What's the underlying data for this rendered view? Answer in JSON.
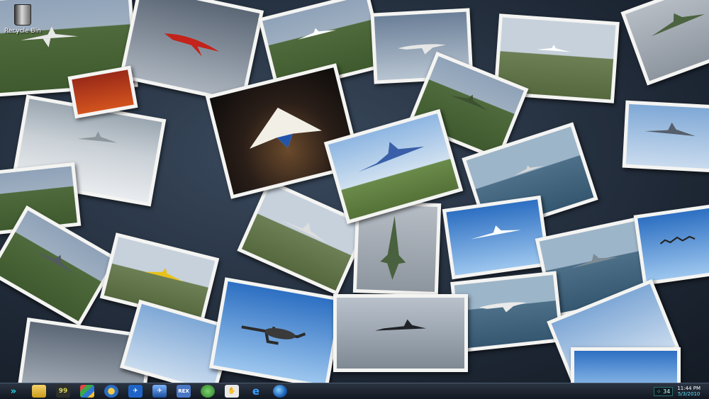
{
  "desktop": {
    "icons": [
      {
        "label": "Recycle Bin",
        "icon": "recycle-bin-icon"
      }
    ],
    "wallpaper_description_icon": "aircraft-photo-collage"
  },
  "taskbar": {
    "start_label": "»",
    "pinned": [
      {
        "name": "folder-icon",
        "label": ""
      },
      {
        "name": "app-99-icon",
        "label": "99"
      },
      {
        "name": "media-center-icon",
        "label": ""
      },
      {
        "name": "flight-sim-compass-icon",
        "label": ""
      },
      {
        "name": "flight-sim-plane-icon",
        "label": ""
      },
      {
        "name": "sim-launcher-icon",
        "label": ""
      },
      {
        "name": "rex-icon",
        "label": "REX"
      },
      {
        "name": "green-app-icon",
        "label": ""
      },
      {
        "name": "utility-app-icon",
        "label": ""
      },
      {
        "name": "internet-explorer-icon",
        "label": "e"
      },
      {
        "name": "google-earth-icon",
        "label": ""
      }
    ],
    "tray": {
      "indicator": "34",
      "time": "11:44 PM",
      "date": "5/3/2010"
    }
  },
  "colors": {
    "accent_cyan": "#27d6e6",
    "taskbar_bg": "#1a212c"
  }
}
